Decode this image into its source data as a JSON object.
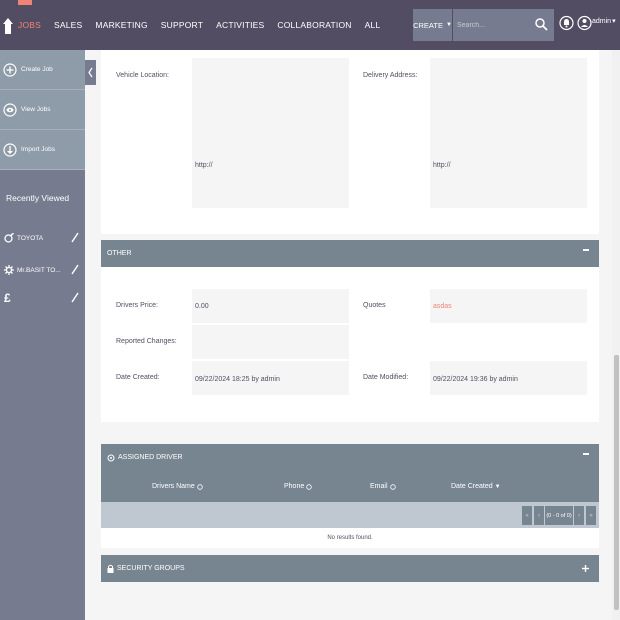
{
  "nav": {
    "items": [
      {
        "label": "JOBS",
        "active": true
      },
      {
        "label": "SALES"
      },
      {
        "label": "MARKETING"
      },
      {
        "label": "SUPPORT"
      },
      {
        "label": "ACTIVITIES"
      },
      {
        "label": "COLLABORATION"
      },
      {
        "label": "ALL"
      }
    ],
    "create_label": "CREATE",
    "search_placeholder": "Search...",
    "user_label": "admin"
  },
  "sidebar": {
    "actions": [
      {
        "label": "Create Job",
        "icon": "plus-circle-icon"
      },
      {
        "label": "View Jobs",
        "icon": "eye-circle-icon"
      },
      {
        "label": "Import Jobs",
        "icon": "import-circle-icon"
      }
    ],
    "recent_title": "Recently Viewed",
    "recent_items": [
      {
        "label": "TOYOTA",
        "icon": "wrench-icon"
      },
      {
        "label": "Mr.BASIT TO...",
        "icon": "gear-icon"
      },
      {
        "label": "",
        "icon": "pound-icon"
      }
    ]
  },
  "location": {
    "vehicle_location_label": "Vehicle Location:",
    "vehicle_location_value": "http://",
    "delivery_address_label": "Delivery Address:",
    "delivery_address_value": "http://"
  },
  "other": {
    "title": "OTHER",
    "drivers_price_label": "Drivers Price:",
    "drivers_price_value": "0.00",
    "quotes_label": "Quotes",
    "quotes_value": "asdas",
    "reported_changes_label": "Reported Changes:",
    "reported_changes_value": "",
    "date_created_label": "Date Created:",
    "date_created_value": "09/22/2024 18:25 by admin",
    "date_modified_label": "Date Modified:",
    "date_modified_value": "09/22/2024 19:36 by admin"
  },
  "assigned_driver": {
    "title": "ASSIGNED DRIVER",
    "columns": [
      "Drivers Name",
      "Phone",
      "Email",
      "Date Created"
    ],
    "pager_text": "(0 - 0 of 0)",
    "no_results": "No results found."
  },
  "security_groups": {
    "title": "SECURITY GROUPS"
  },
  "colors": {
    "topbar": "#534d64",
    "accent": "#f08377",
    "panel_header": "#778591"
  }
}
